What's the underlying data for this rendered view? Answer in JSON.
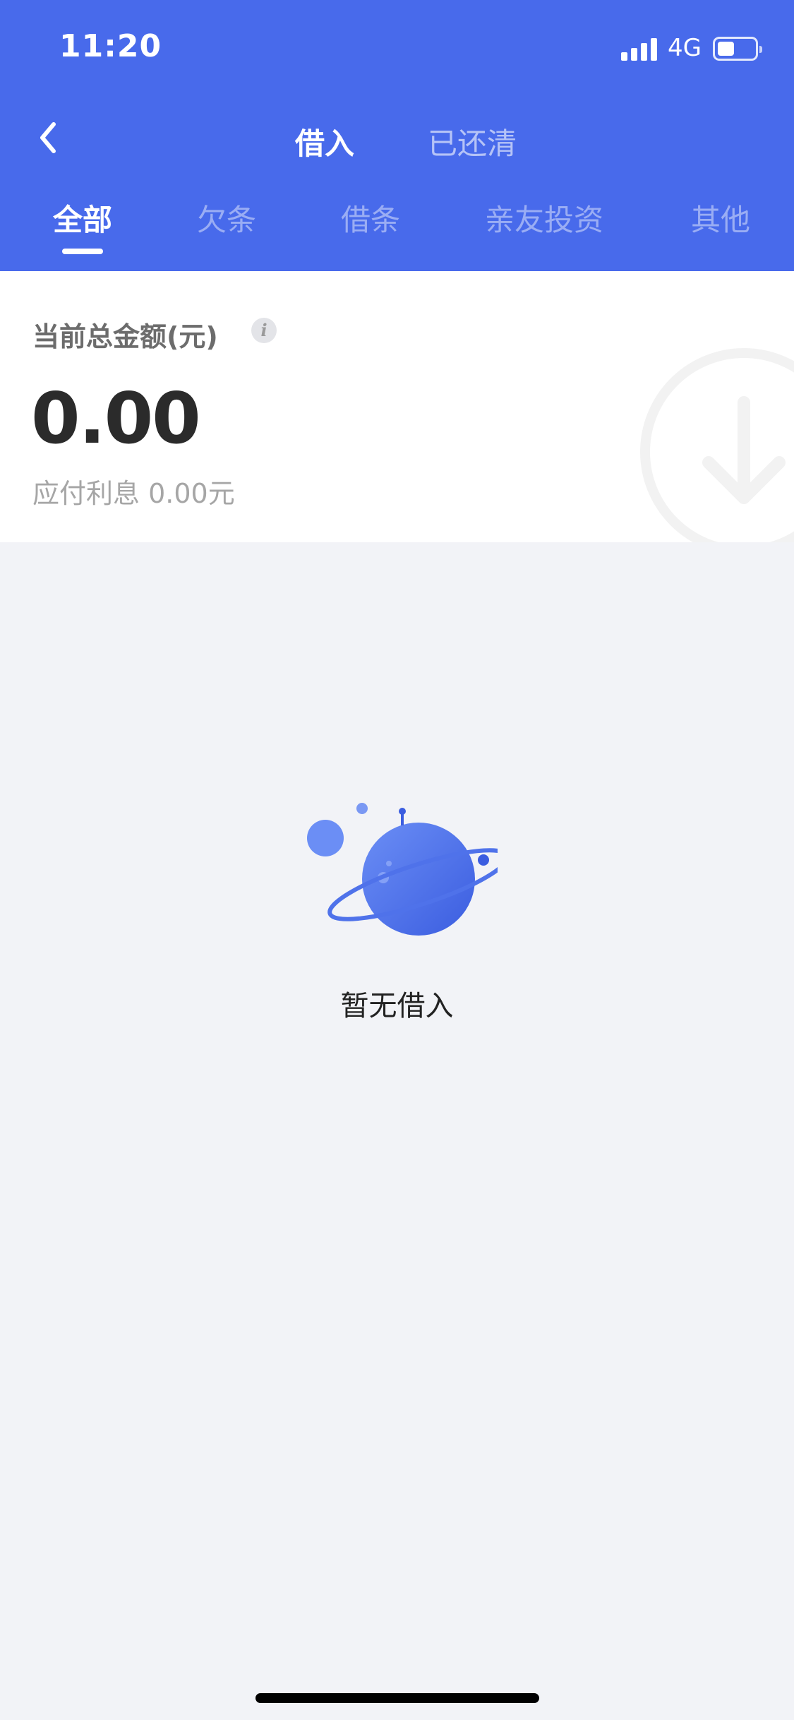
{
  "status_bar": {
    "time": "11:20",
    "network": "4G",
    "battery_level": 0.45,
    "signal_bars": 4
  },
  "nav": {
    "segments": [
      {
        "label": "借入",
        "active": true
      },
      {
        "label": "已还清",
        "active": false
      }
    ],
    "back_icon": "chevron-left-icon"
  },
  "tabs": [
    {
      "label": "全部",
      "active": true
    },
    {
      "label": "欠条",
      "active": false
    },
    {
      "label": "借条",
      "active": false
    },
    {
      "label": "亲友投资",
      "active": false
    },
    {
      "label": "其他",
      "active": false
    }
  ],
  "summary": {
    "title": "当前总金额(元)",
    "info_icon": "info-icon",
    "info_glyph": "i",
    "amount": "0.00",
    "interest": "应付利息 0.00元",
    "watermark_icon": "arrow-down-circle-icon"
  },
  "empty_state": {
    "illustration": "planet-icon",
    "text": "暂无借入"
  },
  "colors": {
    "primary": "#486aeb",
    "background": "#f2f3f7"
  }
}
